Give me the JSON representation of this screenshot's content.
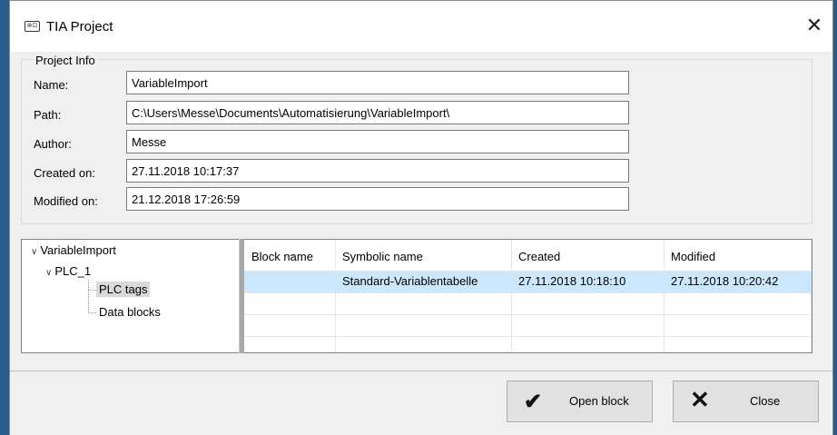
{
  "window": {
    "title": "TIA Project",
    "icon": "tia-icon",
    "icon_glyph": "⊗⊡"
  },
  "project_info": {
    "legend": "Project Info",
    "fields": [
      {
        "label": "Name:",
        "value": "VariableImport"
      },
      {
        "label": "Path:",
        "value": "C:\\Users\\Messe\\Documents\\Automatisierung\\VariableImport\\"
      },
      {
        "label": "Author:",
        "value": "Messe"
      },
      {
        "label": "Created on:",
        "value": "27.11.2018 10:17:37"
      },
      {
        "label": "Modified on:",
        "value": "21.12.2018 17:26:59"
      }
    ]
  },
  "tree": {
    "root": "VariableImport",
    "plc": "PLC_1",
    "children": [
      "PLC tags",
      "Data blocks"
    ],
    "selected": "PLC tags"
  },
  "grid": {
    "columns": [
      "Block name",
      "Symbolic name",
      "Created",
      "Modified"
    ],
    "rows": [
      {
        "block_name": "",
        "symbolic_name": "Standard-Variablentabelle",
        "created": "27.11.2018 10:18:10",
        "modified": "27.11.2018 10:20:42"
      }
    ]
  },
  "buttons": {
    "open": {
      "label": "Open block",
      "icon": "checkmark-icon"
    },
    "close": {
      "label": "Close",
      "icon": "x-icon"
    }
  },
  "colors": {
    "selection": "#cce8ff",
    "tree_selected": "#d9d9d9"
  }
}
